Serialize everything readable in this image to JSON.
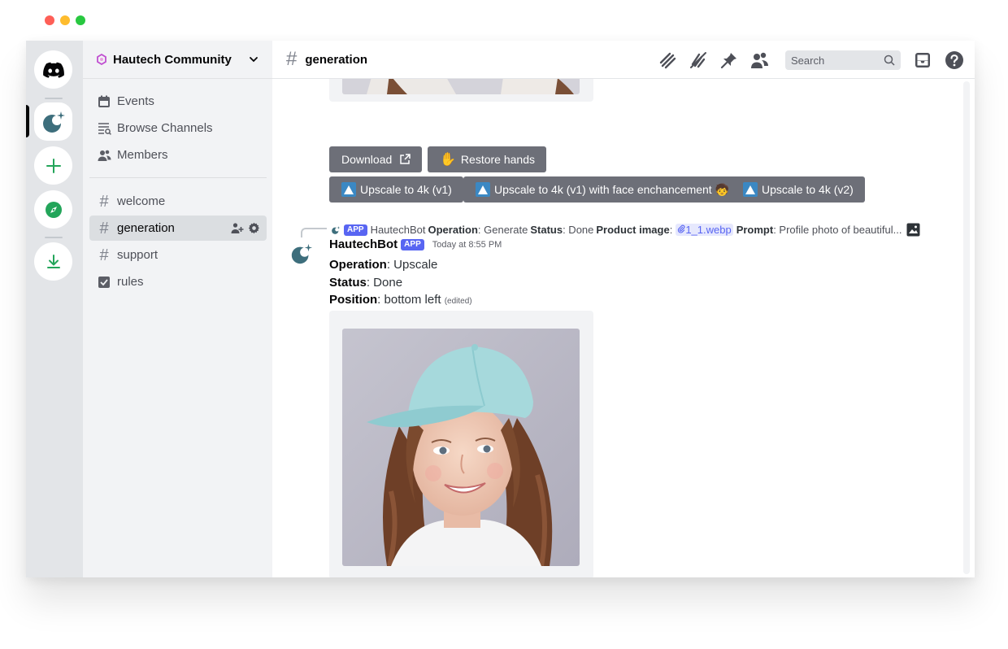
{
  "window": {
    "colors": {
      "red": "#fe5f57",
      "yellow": "#febc2e",
      "green": "#28c840"
    }
  },
  "rail": {
    "icons": [
      "discord-logo-icon",
      "hautech-server-icon",
      "add-server-icon",
      "explore-icon",
      "download-icon"
    ]
  },
  "server": {
    "name": "Hautech Community"
  },
  "sidebar": {
    "nav": [
      {
        "label": "Events",
        "icon": "calendar-icon"
      },
      {
        "label": "Browse Channels",
        "icon": "browse-channels-icon"
      },
      {
        "label": "Members",
        "icon": "members-icon"
      }
    ],
    "channels": [
      {
        "label": "welcome",
        "icon": "hash-icon"
      },
      {
        "label": "generation",
        "icon": "hash-icon",
        "selected": true
      },
      {
        "label": "support",
        "icon": "hash-icon"
      },
      {
        "label": "rules",
        "icon": "rules-icon"
      }
    ]
  },
  "header": {
    "channel": "generation",
    "search_placeholder": "Search",
    "icons": [
      "threads-icon",
      "notifications-muted-icon",
      "pin-icon",
      "member-list-icon",
      "inbox-icon",
      "help-icon"
    ]
  },
  "buttons": {
    "download": "Download",
    "restore": "Restore hands",
    "upscale_v1": "Upscale to 4k (v1)",
    "upscale_face": "Upscale to 4k (v1) with face enchancement 🧒",
    "upscale_v2": "Upscale to 4k (v2)"
  },
  "reply": {
    "app_tag": "APP",
    "author": "HautechBot",
    "operation_label": "Operation",
    "operation_value": ": Generate ",
    "status_label": "Status",
    "status_value": ": Done ",
    "product_label": "Product image",
    "product_sep": ":",
    "attachment": "1_1.webp",
    "prompt_label": "Prompt",
    "prompt_value": ": Profile photo of beautiful..."
  },
  "message": {
    "author": "HautechBot",
    "app_tag": "APP",
    "timestamp": "Today at 8:55 PM",
    "operation_label": "Operation",
    "operation_value": ": Upscale",
    "status_label": "Status",
    "status_value": ": Done",
    "position_label": "Position",
    "position_value": ": bottom left",
    "edited": "(edited)"
  }
}
